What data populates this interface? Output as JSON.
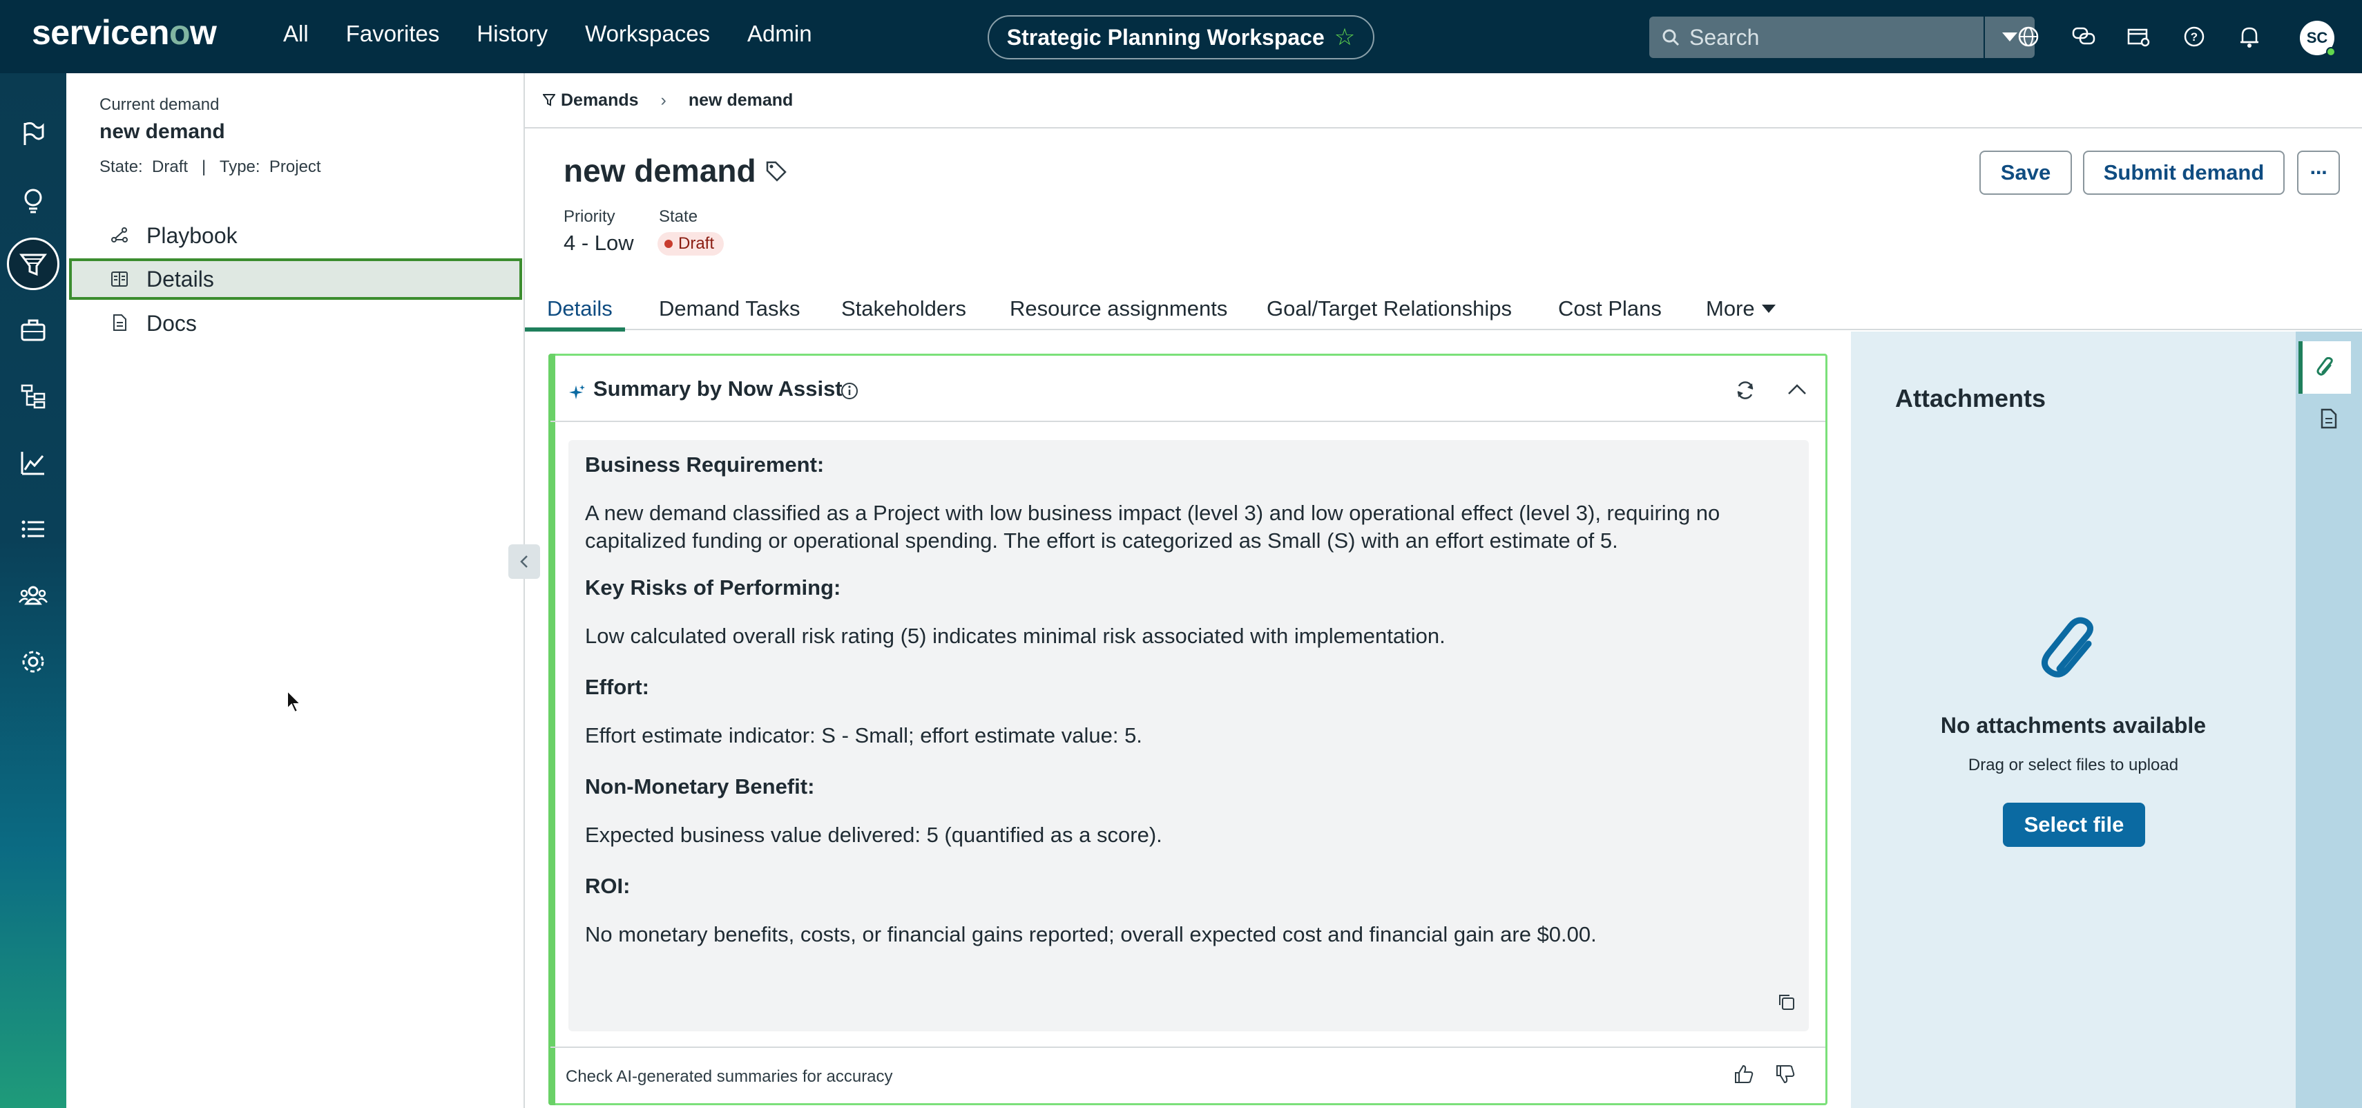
{
  "topbar": {
    "brand": "servicenow",
    "nav": [
      "All",
      "Favorites",
      "History",
      "Workspaces",
      "Admin"
    ],
    "workspace_title": "Strategic Planning Workspace",
    "search_placeholder": "Search",
    "avatar_initials": "SC",
    "icons": [
      "globe-icon",
      "chat-icon",
      "inbox-icon",
      "help-icon",
      "bell-icon"
    ]
  },
  "left_panel": {
    "current_label": "Current demand",
    "current_title": "new demand",
    "meta": "State:  Draft   |   Type:  Project",
    "items": [
      {
        "label": "Playbook",
        "icon": "playbook-icon"
      },
      {
        "label": "Details",
        "icon": "details-icon",
        "active": true
      },
      {
        "label": "Docs",
        "icon": "docs-icon"
      }
    ]
  },
  "breadcrumb": {
    "parent": "Demands",
    "current": "new demand"
  },
  "record": {
    "title": "new demand",
    "priority_label": "Priority",
    "priority_value": "4 - Low",
    "state_label": "State",
    "state_value": "Draft",
    "save_label": "Save",
    "submit_label": "Submit demand",
    "more_label": "···"
  },
  "tabs": [
    "Details",
    "Demand Tasks",
    "Stakeholders",
    "Resource assignments",
    "Goal/Target Relationships",
    "Cost Plans",
    "More"
  ],
  "summary": {
    "title": "Summary by Now Assist",
    "sections": [
      {
        "heading": "Business Requirement:",
        "text": "A new demand classified as a Project with low business impact (level 3) and low operational effect (level 3), requiring no capitalized funding or operational spending. The effort is categorized as Small (S) with an effort estimate of 5."
      },
      {
        "heading": "Key Risks of Performing:",
        "text": "Low calculated overall risk rating (5) indicates minimal risk associated with implementation."
      },
      {
        "heading": "Effort:",
        "text": "Effort estimate indicator: S - Small; effort estimate value: 5."
      },
      {
        "heading": "Non-Monetary Benefit:",
        "text": "Expected business value delivered: 5 (quantified as a score)."
      },
      {
        "heading": "ROI:",
        "text": "No monetary benefits, costs, or financial gains reported; overall expected cost and financial gain are $0.00."
      }
    ],
    "footer": "Check AI-generated summaries for accuracy"
  },
  "attachments": {
    "title": "Attachments",
    "empty": "No attachments available",
    "hint": "Drag or select files to upload",
    "button": "Select file"
  }
}
